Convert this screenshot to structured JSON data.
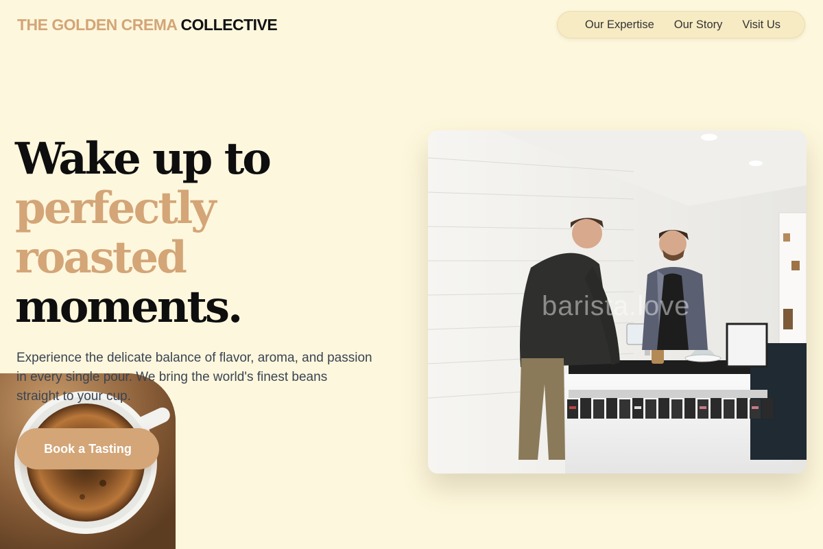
{
  "brand": {
    "part1": "THE GOLDEN CREMA",
    "part2": "COLLECTIVE"
  },
  "nav": {
    "items": [
      "Our Expertise",
      "Our Story",
      "Visit Us"
    ]
  },
  "hero": {
    "line1": "Wake up to",
    "line2": "perfectly",
    "line3": "roasted",
    "line4": "moments.",
    "subtitle": "Experience the delicate balance of flavor, aroma, and passion in every single pour. We bring the world's finest beans straight to your cup.",
    "cta_label": "Book a Tasting"
  },
  "images": {
    "cup": "coffee-cup-photo",
    "shop": "coffee-shop-counter-photo",
    "watermark": "barista.love"
  },
  "colors": {
    "background": "#fdf7dd",
    "accent": "#d3a577",
    "heading": "#0e0e0e",
    "body_text": "#3a4452",
    "nav_pill": "#f7ebc4"
  }
}
